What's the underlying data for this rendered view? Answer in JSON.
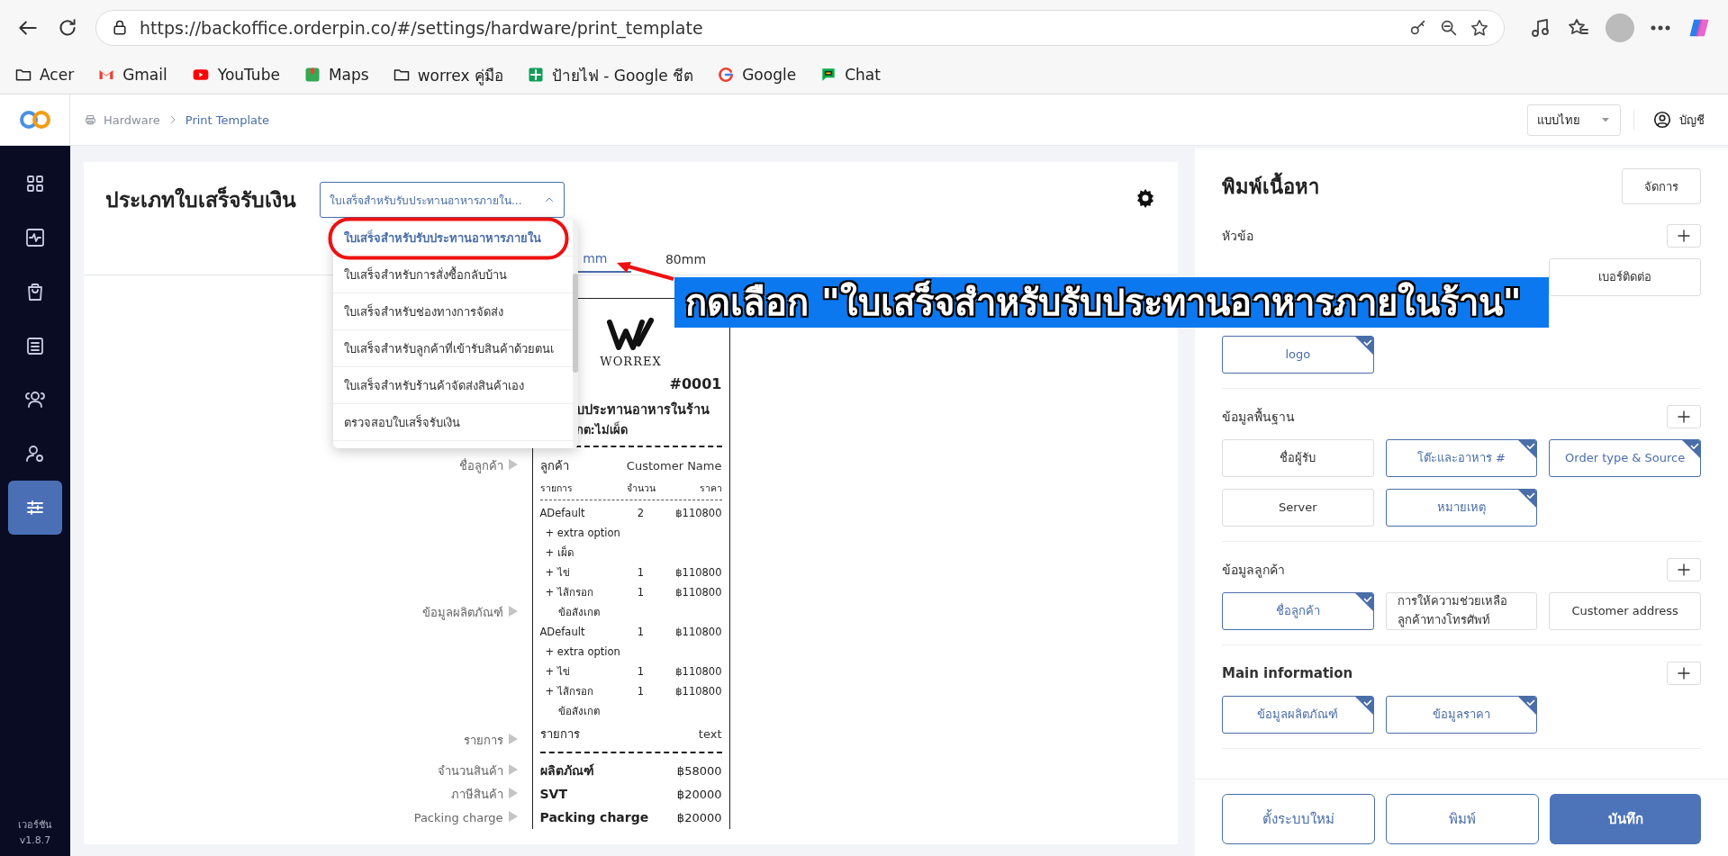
{
  "browser": {
    "url": "https://backoffice.orderpin.co/#/settings/hardware/print_template",
    "bookmarks": [
      {
        "label": "Acer",
        "kind": "folder"
      },
      {
        "label": "Gmail",
        "kind": "gmail"
      },
      {
        "label": "YouTube",
        "kind": "youtube"
      },
      {
        "label": "Maps",
        "kind": "maps"
      },
      {
        "label": "worrex คู่มือ",
        "kind": "folder"
      },
      {
        "label": "ป้ายไฟ - Google ชีต",
        "kind": "sheets"
      },
      {
        "label": "Google",
        "kind": "google"
      },
      {
        "label": "Chat",
        "kind": "chat"
      }
    ]
  },
  "header": {
    "breadcrumb": [
      {
        "label": "Hardware"
      },
      {
        "label": "Print Template"
      }
    ],
    "language": "แบบไทย",
    "account": "บัญชี"
  },
  "sidebar": {
    "items": [
      {
        "kind": "grid",
        "selected": false
      },
      {
        "kind": "activity",
        "selected": false
      },
      {
        "kind": "bag",
        "selected": false
      },
      {
        "kind": "building",
        "selected": false
      },
      {
        "kind": "users",
        "selected": false
      },
      {
        "kind": "user-gear",
        "selected": false
      },
      {
        "kind": "sliders",
        "selected": true
      }
    ],
    "version_label": "เวอร์ชัน",
    "version": "v1.8.7"
  },
  "template": {
    "title": "ประเภทใบเสร็จรับเงิน",
    "select_value": "ใบเสร็จสำหรับรับประทานอาหารภายใน...",
    "dropdown": [
      {
        "label": "ใบเสร็จสำหรับรับประทานอาหารภายใน",
        "selected": true
      },
      {
        "label": "ใบเสร็จสำหรับการสั่งซื้อกลับบ้าน",
        "selected": false
      },
      {
        "label": "ใบเสร็จสำหรับช่องทางการจัดส่ง",
        "selected": false
      },
      {
        "label": "ใบเสร็จสำหรับลูกค้าที่เข้ารับสินค้าด้วยตนเ",
        "selected": false
      },
      {
        "label": "ใบเสร็จสำหรับร้านค้าจัดส่งสินค้าเอง",
        "selected": false
      },
      {
        "label": "ตรวจสอบใบเสร็จรับเงิน",
        "selected": false
      }
    ],
    "tabs": [
      {
        "label": "mm",
        "selected": true
      },
      {
        "label": "80mm",
        "selected": false
      }
    ],
    "receipt": {
      "sections": [
        {
          "rows": [
            {
              "kind": "logo",
              "name": "WORREX"
            },
            {
              "kind": "number",
              "name": "#0001"
            },
            {
              "kind": "title",
              "name": "บประทานอาหารในร้าน"
            },
            {
              "kind": "subtitle",
              "name": "กต:ไม่เผ็ด"
            },
            {
              "kind": "divider"
            }
          ]
        },
        {
          "side_label": "ชื่อลูกค้า",
          "rows": [
            {
              "kind": "pair",
              "name": "ลูกค้า",
              "price": "Customer Name"
            }
          ]
        },
        {
          "rows": [
            {
              "kind": "columns",
              "name": "รายการ",
              "qty": "จำนวน",
              "price": "ราคา"
            },
            {
              "kind": "thin-divider"
            }
          ]
        },
        {
          "side_label": "ข้อมูลผลิตภัณฑ์",
          "rows": [
            {
              "kind": "item",
              "name": "ADefault",
              "qty": "2",
              "price": "฿110800"
            },
            {
              "kind": "option",
              "name": "+ extra option"
            },
            {
              "kind": "option",
              "name": "+ เผ็ด"
            },
            {
              "kind": "option",
              "name": "+ ไข่",
              "qty": "1",
              "price": "฿110800"
            },
            {
              "kind": "option",
              "name": "+ ไส้กรอก",
              "qty": "1",
              "price": "฿110800"
            },
            {
              "kind": "note",
              "name": "ข้อสังเกต"
            },
            {
              "kind": "item",
              "name": "ADefault",
              "qty": "1",
              "price": "฿110800"
            },
            {
              "kind": "option",
              "name": "+ extra option"
            },
            {
              "kind": "option",
              "name": "+ ไข่",
              "qty": "1",
              "price": "฿110800"
            },
            {
              "kind": "option",
              "name": "+ ไส้กรอก",
              "qty": "1",
              "price": "฿110800"
            },
            {
              "kind": "note",
              "name": "ข้อสังเกต"
            }
          ]
        },
        {
          "side_label": "รายการ",
          "rows": [
            {
              "kind": "pair",
              "name": "รายการ",
              "price": "text"
            },
            {
              "kind": "divider"
            }
          ]
        },
        {
          "side_label": "จำนวนสินค้า",
          "rows": [
            {
              "kind": "total",
              "name": "ผลิตภัณฑ์",
              "price": "฿58000"
            }
          ]
        },
        {
          "side_label": "ภาษีสินค้า",
          "rows": [
            {
              "kind": "total",
              "name": "SVT",
              "price": "฿20000"
            }
          ]
        },
        {
          "side_label": "Packing charge",
          "rows": [
            {
              "kind": "total",
              "name": "Packing charge",
              "price": "฿20000"
            }
          ]
        }
      ]
    }
  },
  "content_panel": {
    "title": "พิมพ์เนื้อหา",
    "manage_button": "จัดการ",
    "sections": [
      {
        "title": "หัวข้อ",
        "kind": "header",
        "bold": false,
        "chips": [
          {
            "label": "เบอร์ติดต่อ",
            "selected": false
          },
          {
            "label": "logo",
            "selected": true
          }
        ]
      },
      {
        "title": "ข้อมูลพื้นฐาน",
        "kind": "normal",
        "bold": false,
        "chips": [
          {
            "label": "ชื่อผู้รับ",
            "selected": false
          },
          {
            "label": "โต๊ะและอาหาร #",
            "selected": true
          },
          {
            "label": "Order type & Source",
            "selected": true
          },
          {
            "label": "Server",
            "selected": false
          },
          {
            "label": "หมายเหตุ",
            "selected": true
          }
        ]
      },
      {
        "title": "ข้อมูลลูกค้า",
        "kind": "normal",
        "bold": false,
        "chips": [
          {
            "label": "ชื่อลูกค้า",
            "selected": true
          },
          {
            "label": "การให้ความช่วยเหลือลูกค้าทางโทรศัพท์",
            "selected": false
          },
          {
            "label": "Customer address",
            "selected": false
          }
        ]
      },
      {
        "title": "Main information",
        "kind": "normal",
        "bold": true,
        "chips": [
          {
            "label": "ข้อมูลผลิตภัณฑ์",
            "selected": true
          },
          {
            "label": "ข้อมูลราคา",
            "selected": true
          }
        ]
      }
    ],
    "actions": [
      {
        "label": "ตั้งระบบใหม่",
        "kind": "outline"
      },
      {
        "label": "พิมพ์",
        "kind": "outline"
      },
      {
        "label": "บันทึก",
        "kind": "primary"
      }
    ]
  },
  "annotation": {
    "banner": "กดเลือก \"ใบเสร็จสำหรับรับประทานอาหารภายในร้าน\""
  }
}
